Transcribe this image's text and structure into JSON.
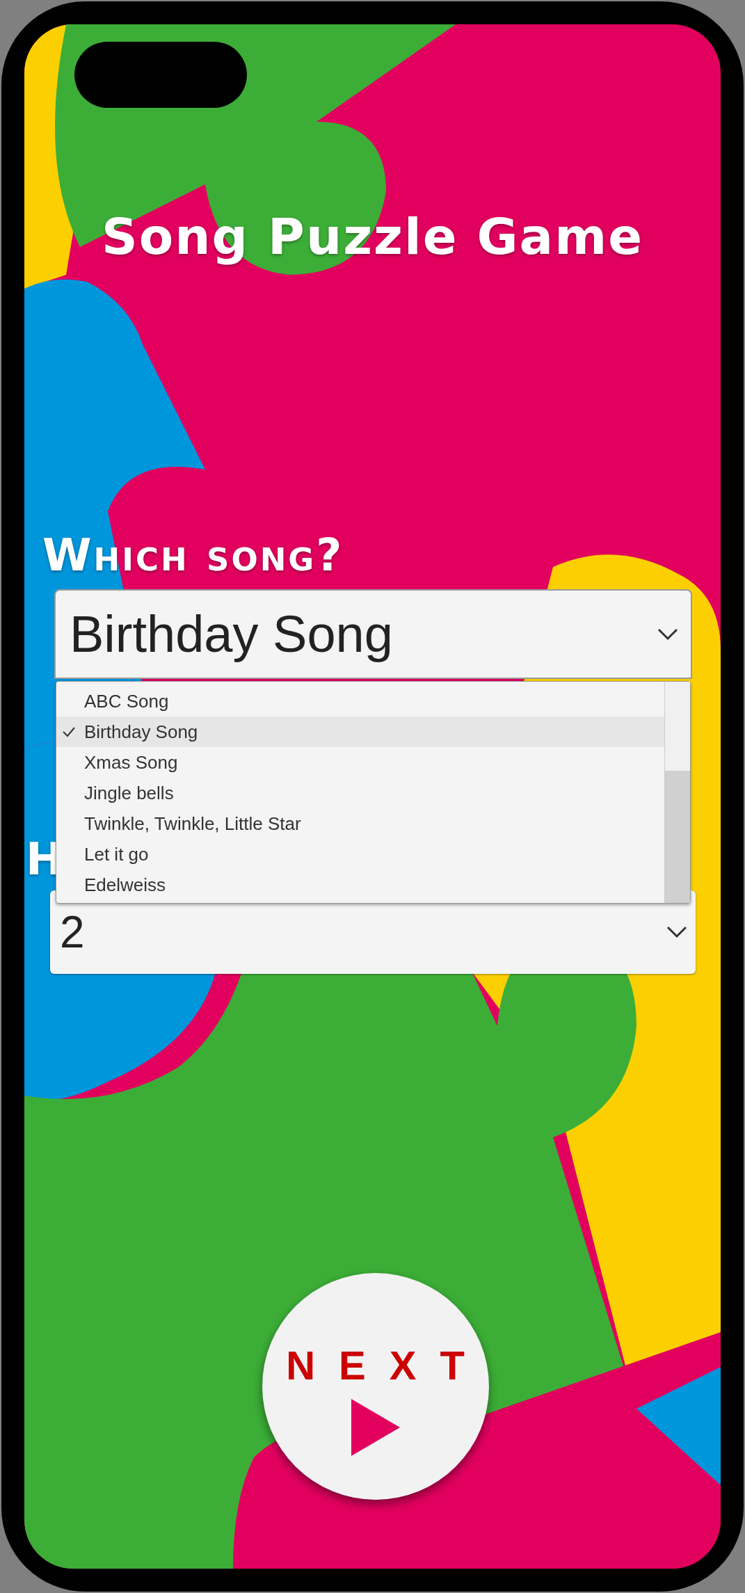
{
  "title": "Song Puzzle Game",
  "song_question": {
    "label": "Which song?",
    "value": "Birthday Song",
    "expanded": true,
    "options": [
      {
        "label": "ABC Song",
        "selected": false
      },
      {
        "label": "Birthday Song",
        "selected": true
      },
      {
        "label": "Xmas Song",
        "selected": false
      },
      {
        "label": "Jingle bells",
        "selected": false
      },
      {
        "label": "Twinkle, Twinkle, Little Star",
        "selected": false
      },
      {
        "label": "Let it go",
        "selected": false
      },
      {
        "label": "Edelweiss",
        "selected": false
      }
    ]
  },
  "second_question": {
    "label": "H",
    "value": "2"
  },
  "next_button": {
    "label": "NEXT"
  }
}
